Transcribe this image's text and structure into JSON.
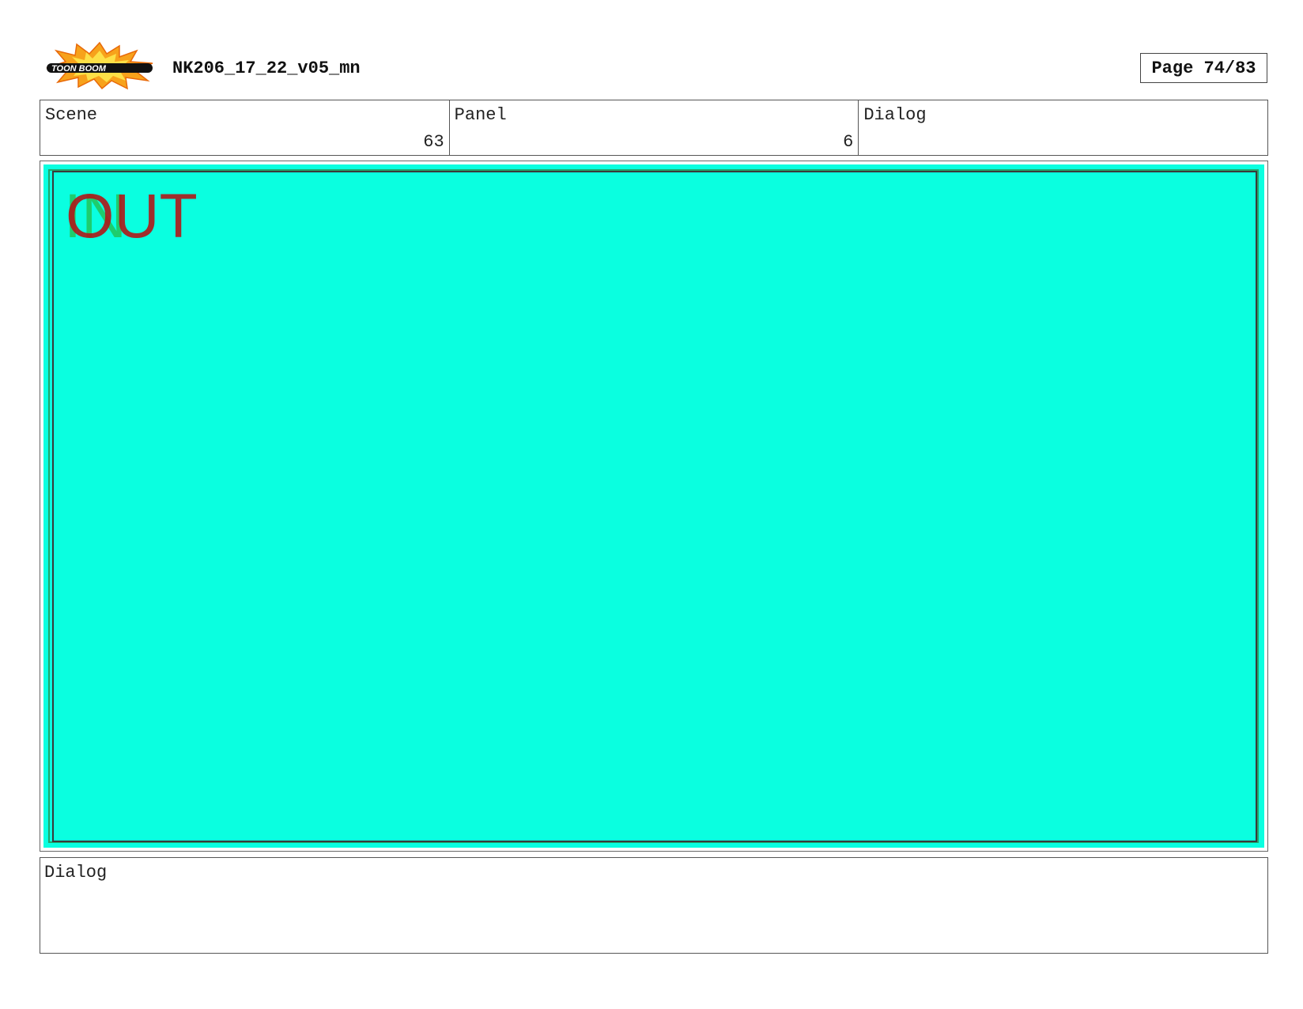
{
  "header": {
    "logo_text": "TOON BOOM",
    "project_title": "NK206_17_22_v05_mn",
    "page_label": "Page 74/83"
  },
  "info": {
    "scene_label": "Scene",
    "scene_value": "63",
    "panel_label": "Panel",
    "panel_value": "6",
    "dialog_label": "Dialog"
  },
  "panel": {
    "in_marker": "IN",
    "out_marker": "OUT",
    "background_color": "#0affe0",
    "in_color": "#22c55a",
    "out_color": "#b01818"
  },
  "dialog": {
    "label": "Dialog",
    "text": ""
  }
}
